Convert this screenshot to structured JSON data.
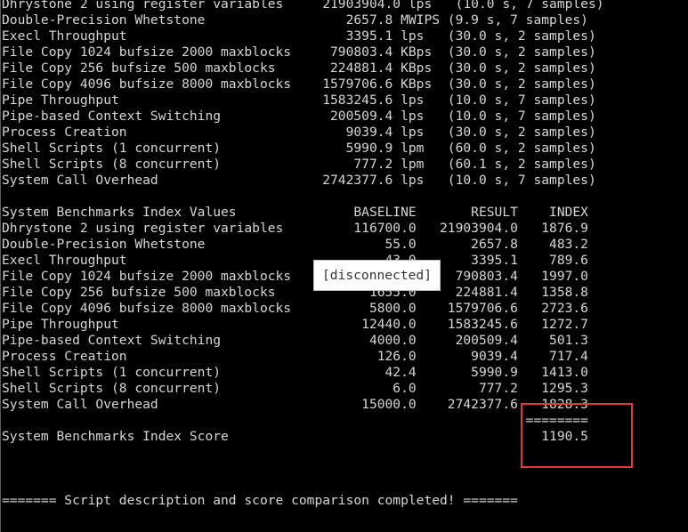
{
  "terminal": {
    "lines": [
      "Dhrystone 2 using register variables     21903904.0 lps   (10.0 s, 7 samples)",
      "Double-Precision Whetstone                  2657.8 MWIPS (9.9 s, 7 samples)",
      "Execl Throughput                            3395.1 lps   (30.0 s, 2 samples)",
      "File Copy 1024 bufsize 2000 maxblocks     790803.4 KBps  (30.0 s, 2 samples)",
      "File Copy 256 bufsize 500 maxblocks       224881.4 KBps  (30.0 s, 2 samples)",
      "File Copy 4096 bufsize 8000 maxblocks    1579706.6 KBps  (30.0 s, 2 samples)",
      "Pipe Throughput                          1583245.6 lps   (10.0 s, 7 samples)",
      "Pipe-based Context Switching              200509.4 lps   (10.0 s, 7 samples)",
      "Process Creation                            9039.4 lps   (30.0 s, 2 samples)",
      "Shell Scripts (1 concurrent)                5990.9 lpm   (60.0 s, 2 samples)",
      "Shell Scripts (8 concurrent)                 777.2 lpm   (60.1 s, 2 samples)",
      "System Call Overhead                     2742377.6 lps   (10.0 s, 7 samples)",
      "",
      "System Benchmarks Index Values               BASELINE       RESULT    INDEX",
      "Dhrystone 2 using register variables         116700.0   21903904.0   1876.9",
      "Double-Precision Whetstone                       55.0       2657.8    483.2",
      "Execl Throughput                                 43.0       3395.1    789.6",
      "File Copy 1024 bufsize 2000 maxblocks          3960.0     790803.4   1997.0",
      "File Copy 256 bufsize 500 maxblocks            1655.0     224881.4   1358.8",
      "File Copy 4096 bufsize 8000 maxblocks          5800.0    1579706.6   2723.6",
      "Pipe Throughput                               12440.0    1583245.6   1272.7",
      "Pipe-based Context Switching                   4000.0     200509.4    501.3",
      "Process Creation                                126.0       9039.4    717.4",
      "Shell Scripts (1 concurrent)                     42.4       5990.9   1413.0",
      "Shell Scripts (8 concurrent)                      6.0        777.2   1295.3",
      "System Call Overhead                          15000.0    2742377.6   1828.3",
      "                                                                   ========",
      "System Benchmarks Index Score                                        1190.5",
      "",
      "",
      "",
      "======= Script description and score comparison completed! ======="
    ]
  },
  "status_overlay": {
    "text": "[disconnected]"
  },
  "highlight": {
    "color": "#e53935",
    "target": "System Benchmarks Index Score"
  }
}
